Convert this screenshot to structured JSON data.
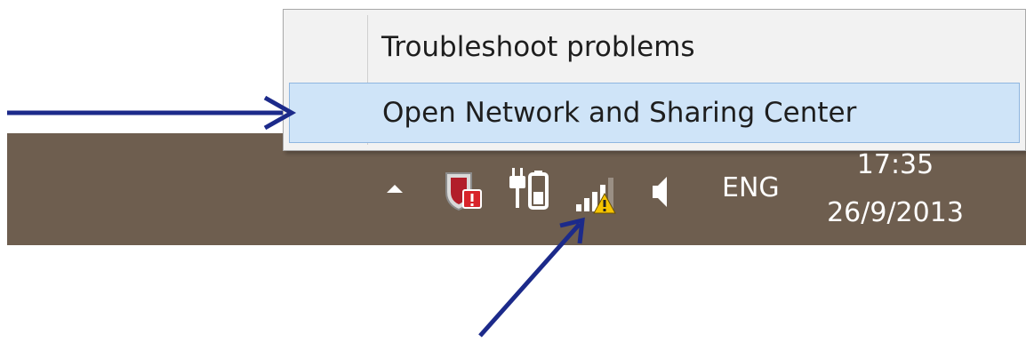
{
  "context_menu": {
    "items": [
      {
        "label": "Troubleshoot problems",
        "highlighted": false
      },
      {
        "label": "Open Network and Sharing Center",
        "highlighted": true
      }
    ]
  },
  "taskbar": {
    "color": "#6e5e4f",
    "tray_icons": [
      {
        "icon": "chevron-up-icon",
        "meaning": "show hidden icons"
      },
      {
        "icon": "security-shield-icon",
        "meaning": "action center"
      },
      {
        "icon": "power-battery-icon",
        "meaning": "power"
      },
      {
        "icon": "network-signal-warning-icon",
        "meaning": "network"
      },
      {
        "icon": "speaker-volume-icon",
        "meaning": "volume"
      }
    ],
    "language": "ENG",
    "clock": {
      "time": "17:35",
      "date": "26/9/2013"
    }
  },
  "annotations": {
    "arrow_color": "#1c2a8a",
    "arrows": [
      "arrow-pointing-to-menu-item",
      "arrow-pointing-to-network-icon"
    ]
  },
  "colors": {
    "menu_background": "#f2f2f2",
    "menu_highlight": "#cfe4f8",
    "menu_highlight_border": "#8fb6e0"
  }
}
